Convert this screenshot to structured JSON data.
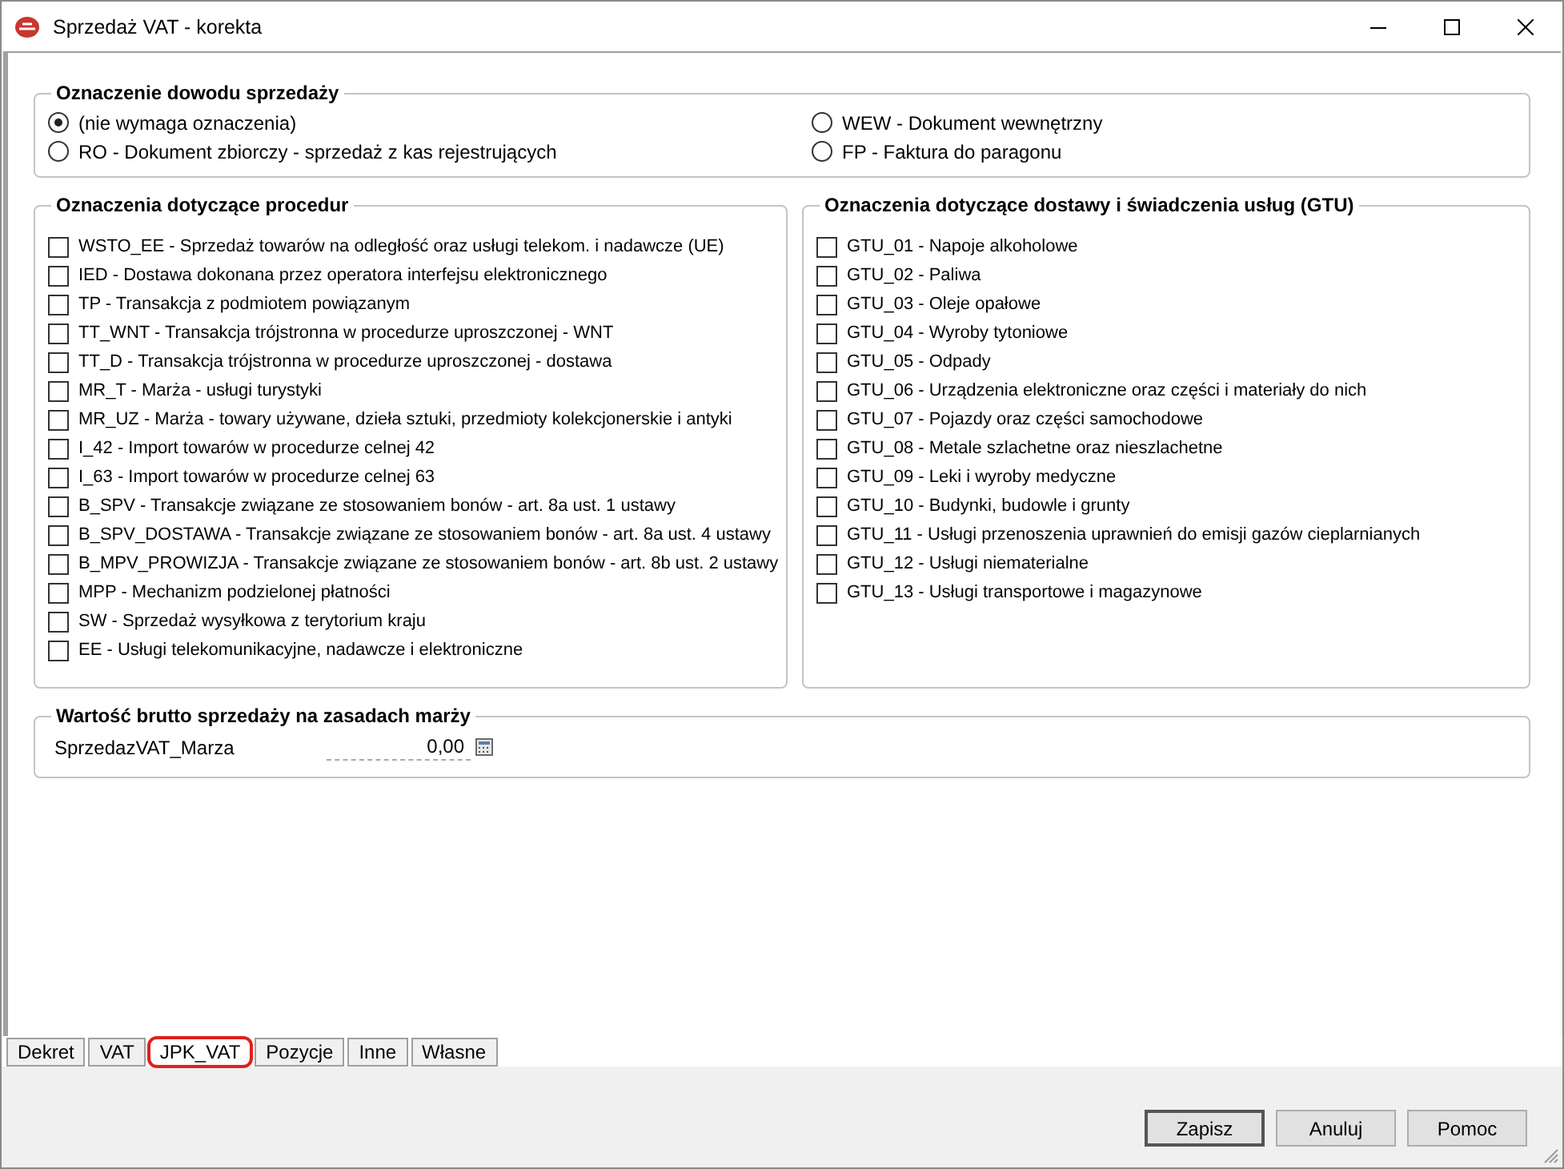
{
  "window": {
    "title": "Sprzedaż VAT - korekta"
  },
  "document_marking": {
    "title": "Oznaczenie dowodu sprzedaży",
    "options": [
      {
        "label": "(nie wymaga oznaczenia)",
        "selected": true
      },
      {
        "label": "WEW - Dokument wewnętrzny",
        "selected": false
      },
      {
        "label": "RO - Dokument zbiorczy - sprzedaż z kas rejestrujących",
        "selected": false
      },
      {
        "label": "FP - Faktura do paragonu",
        "selected": false
      }
    ]
  },
  "procedures": {
    "title": "Oznaczenia dotyczące procedur",
    "items": [
      {
        "label": "WSTO_EE - Sprzedaż towarów na odległość oraz usługi telekom. i nadawcze (UE)",
        "checked": false
      },
      {
        "label": "IED - Dostawa dokonana przez operatora interfejsu elektronicznego",
        "checked": false
      },
      {
        "label": "TP - Transakcja z podmiotem powiązanym",
        "checked": false
      },
      {
        "label": "TT_WNT - Transakcja trójstronna w procedurze uproszczonej - WNT",
        "checked": false
      },
      {
        "label": "TT_D - Transakcja trójstronna w procedurze uproszczonej - dostawa",
        "checked": false
      },
      {
        "label": "MR_T - Marża - usługi turystyki",
        "checked": false
      },
      {
        "label": "MR_UZ - Marża - towary używane, dzieła sztuki, przedmioty kolekcjonerskie i antyki",
        "checked": false
      },
      {
        "label": "I_42 - Import towarów w procedurze celnej 42",
        "checked": false
      },
      {
        "label": "I_63 - Import towarów w procedurze celnej 63",
        "checked": false
      },
      {
        "label": "B_SPV - Transakcje związane ze stosowaniem bonów - art. 8a ust. 1 ustawy",
        "checked": false
      },
      {
        "label": "B_SPV_DOSTAWA - Transakcje związane ze stosowaniem bonów - art. 8a ust. 4 ustawy",
        "checked": false
      },
      {
        "label": "B_MPV_PROWIZJA - Transakcje związane ze stosowaniem bonów - art. 8b ust. 2 ustawy",
        "checked": false
      },
      {
        "label": "MPP - Mechanizm podzielonej płatności",
        "checked": false
      },
      {
        "label": "SW - Sprzedaż wysyłkowa z terytorium kraju",
        "checked": false
      },
      {
        "label": "EE - Usługi telekomunikacyjne, nadawcze i elektroniczne",
        "checked": false
      }
    ]
  },
  "gtu": {
    "title": "Oznaczenia dotyczące dostawy i świadczenia usług (GTU)",
    "items": [
      {
        "label": "GTU_01 - Napoje alkoholowe",
        "checked": false
      },
      {
        "label": "GTU_02 - Paliwa",
        "checked": false
      },
      {
        "label": "GTU_03 - Oleje opałowe",
        "checked": false
      },
      {
        "label": "GTU_04 - Wyroby tytoniowe",
        "checked": false
      },
      {
        "label": "GTU_05 - Odpady",
        "checked": false
      },
      {
        "label": "GTU_06 - Urządzenia elektroniczne oraz części i materiały do nich",
        "checked": false
      },
      {
        "label": "GTU_07 - Pojazdy oraz części samochodowe",
        "checked": false
      },
      {
        "label": "GTU_08 - Metale szlachetne oraz nieszlachetne",
        "checked": false
      },
      {
        "label": "GTU_09 - Leki i wyroby medyczne",
        "checked": false
      },
      {
        "label": "GTU_10 - Budynki, budowle i grunty",
        "checked": false
      },
      {
        "label": "GTU_11 - Usługi przenoszenia uprawnień do emisji gazów cieplarnianych",
        "checked": false
      },
      {
        "label": "GTU_12 - Usługi niematerialne",
        "checked": false
      },
      {
        "label": "GTU_13 - Usługi transportowe i magazynowe",
        "checked": false
      }
    ]
  },
  "margin_value": {
    "title": "Wartość brutto sprzedaży na zasadach marży",
    "label": "SprzedazVAT_Marza",
    "value": "0,00"
  },
  "tabs": [
    {
      "label": "Dekret",
      "selected": false
    },
    {
      "label": "VAT",
      "selected": false
    },
    {
      "label": "JPK_VAT",
      "selected": true
    },
    {
      "label": "Pozycje",
      "selected": false
    },
    {
      "label": "Inne",
      "selected": false
    },
    {
      "label": "Własne",
      "selected": false
    }
  ],
  "buttons": [
    "Zapisz",
    "Anuluj",
    "Pomoc"
  ]
}
